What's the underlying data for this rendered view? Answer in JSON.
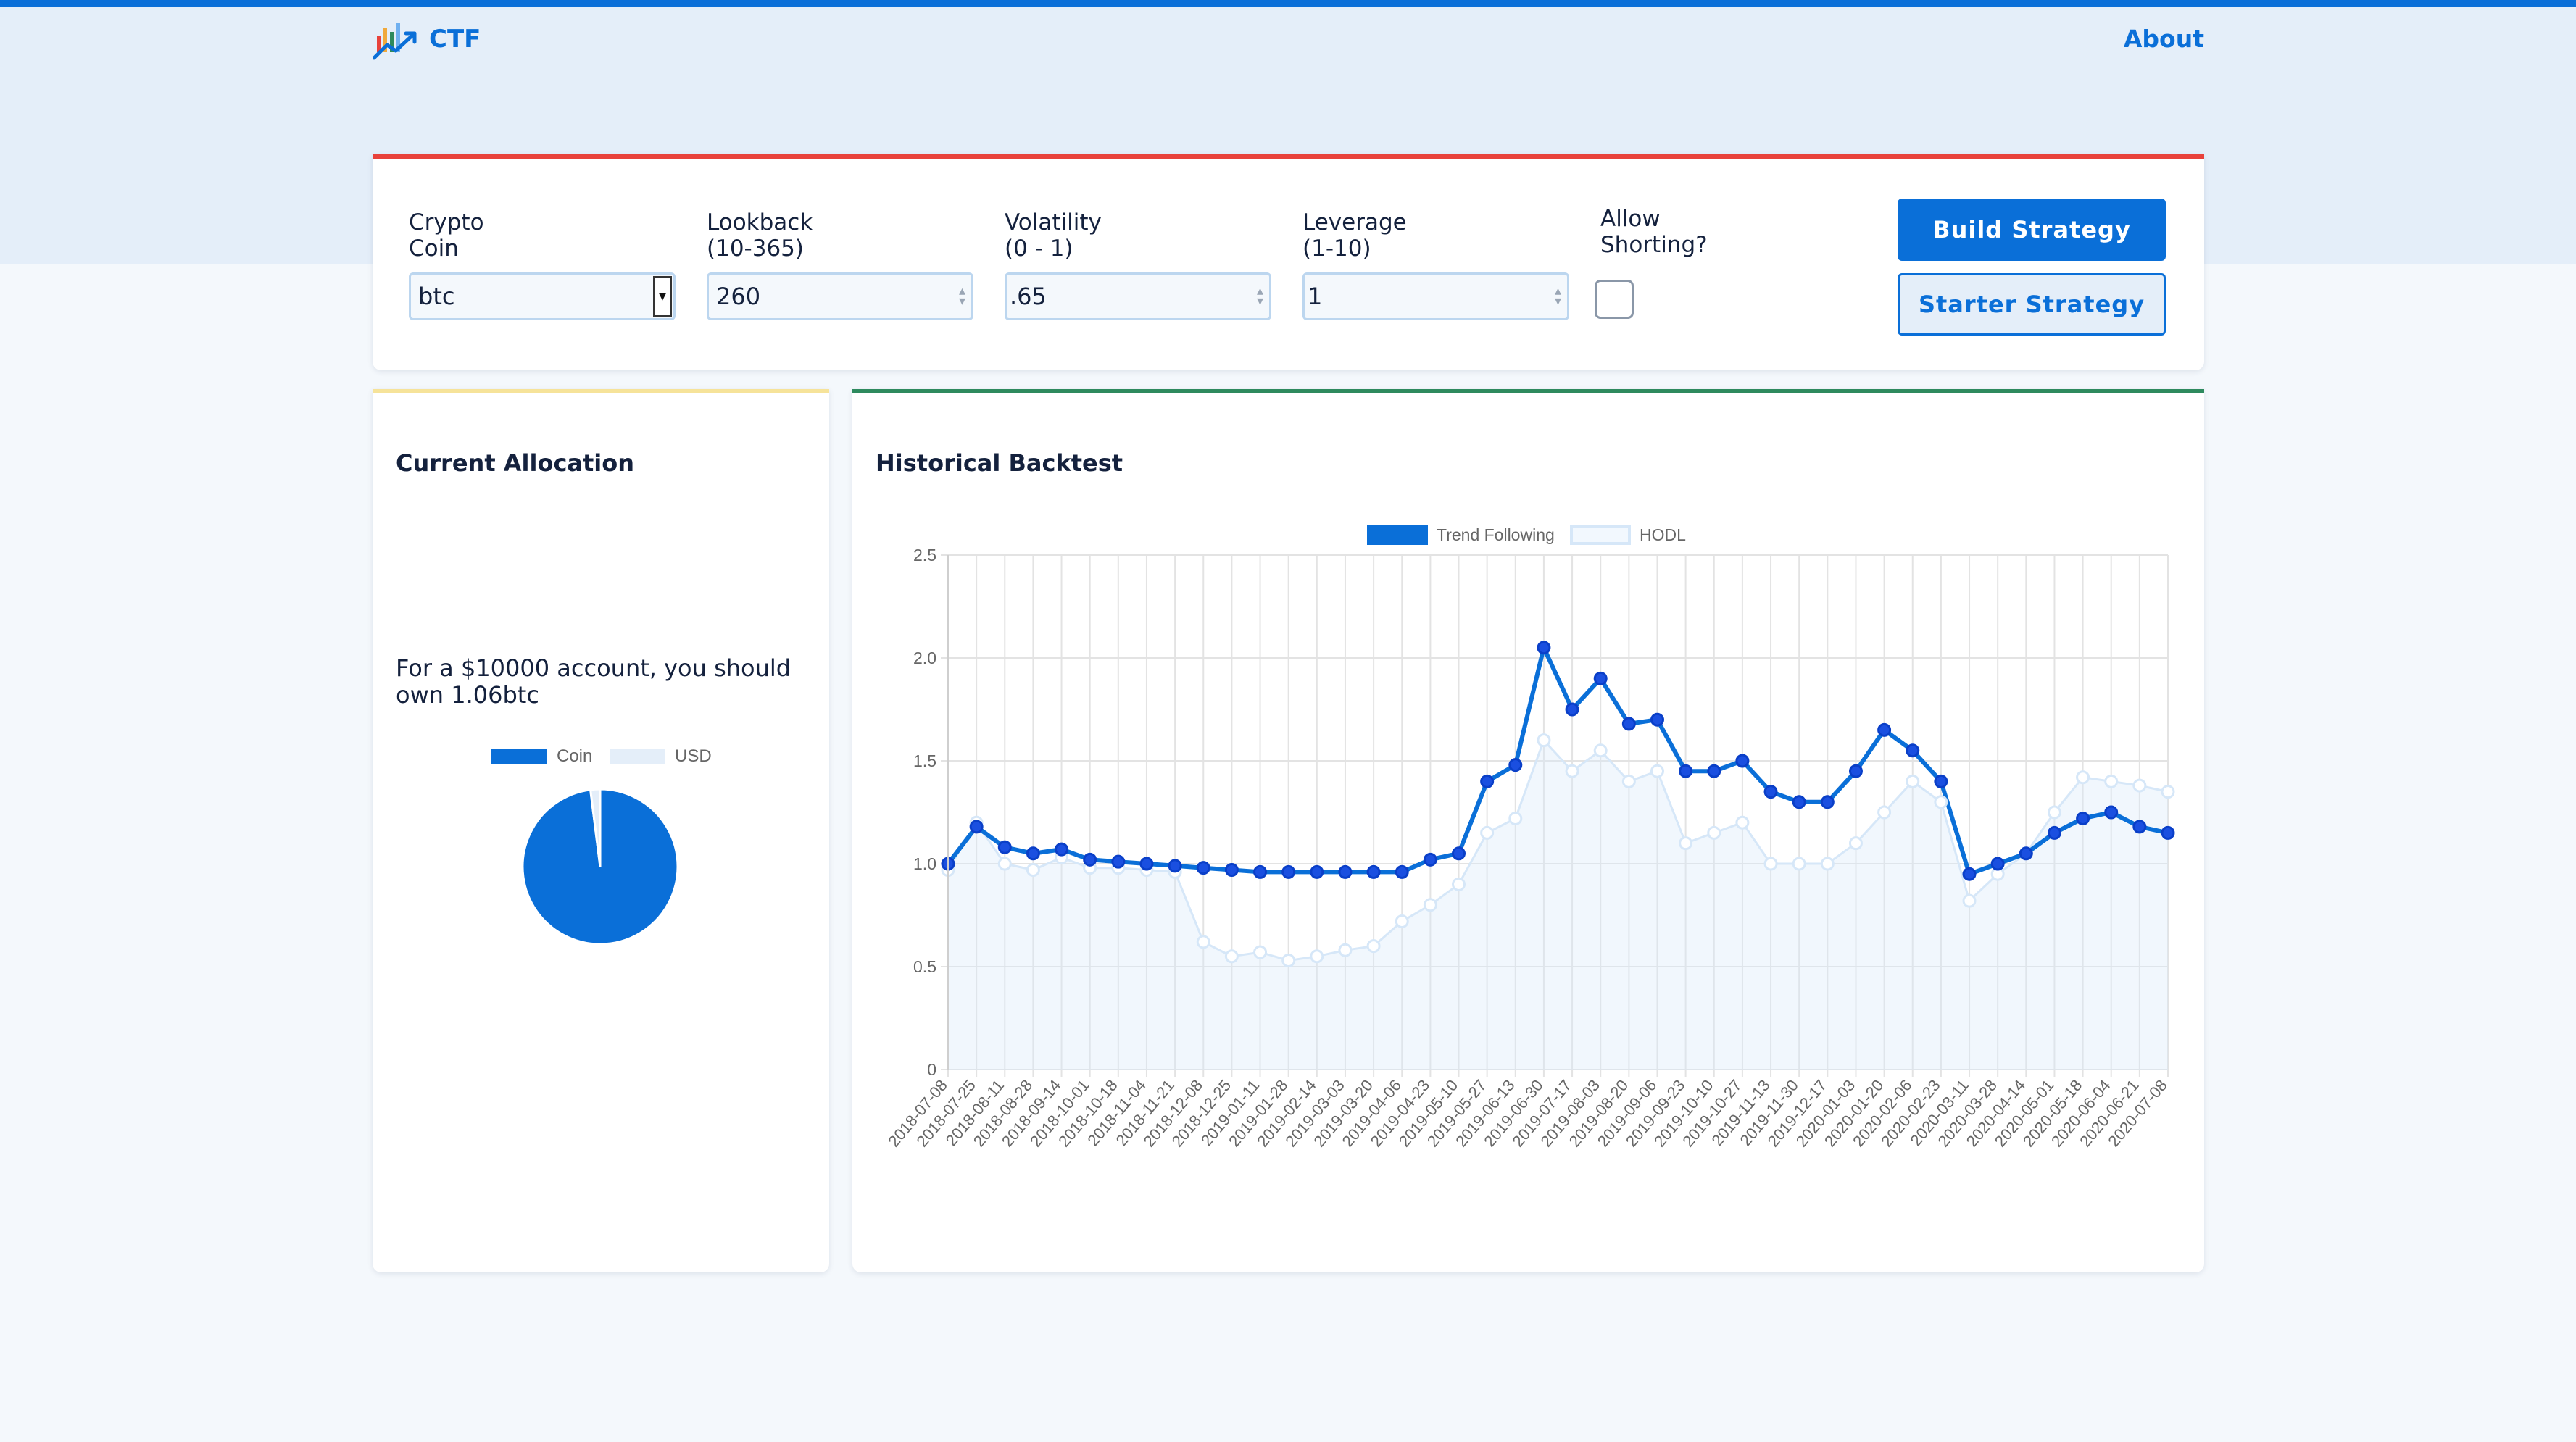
{
  "nav": {
    "brand": "CTF",
    "about": "About"
  },
  "controls": {
    "coin_label": "Crypto\nCoin",
    "coin_value": "btc",
    "lookback_label": "Lookback\n(10-365)",
    "lookback_value": "260",
    "volatility_label": "Volatility\n(0 - 1)",
    "volatility_value": ".65",
    "leverage_label": "Leverage\n(1-10)",
    "leverage_value": "1",
    "shorting_label": "Allow\nShorting?",
    "shorting_checked": false,
    "build_button": "Build Strategy",
    "starter_button": "Starter Strategy"
  },
  "allocation": {
    "title": "Current Allocation",
    "text": "For a $10000 account, you should own 1.06btc",
    "legend_coin": "Coin",
    "legend_usd": "USD",
    "coin_fraction": 0.98,
    "colors": {
      "coin": "#0a6fd8",
      "usd": "#e4eef9"
    }
  },
  "backtest": {
    "title": "Historical Backtest"
  },
  "chart_data": {
    "type": "line",
    "legend": [
      "Trend Following",
      "HODL"
    ],
    "legend_position": "top",
    "ylim": [
      0,
      2.5
    ],
    "yticks": [
      "0",
      "0.5",
      "1.0",
      "1.5",
      "2.0",
      "2.5"
    ],
    "grid": true,
    "x": [
      "2018-07-08",
      "2018-07-25",
      "2018-08-11",
      "2018-08-28",
      "2018-09-14",
      "2018-10-01",
      "2018-10-18",
      "2018-11-04",
      "2018-11-21",
      "2018-12-08",
      "2018-12-25",
      "2019-01-11",
      "2019-01-28",
      "2019-02-14",
      "2019-03-03",
      "2019-03-20",
      "2019-04-06",
      "2019-04-23",
      "2019-05-10",
      "2019-05-27",
      "2019-06-13",
      "2019-06-30",
      "2019-07-17",
      "2019-08-03",
      "2019-08-20",
      "2019-09-06",
      "2019-09-23",
      "2019-10-10",
      "2019-10-27",
      "2019-11-13",
      "2019-11-30",
      "2019-12-17",
      "2020-01-03",
      "2020-01-20",
      "2020-02-06",
      "2020-02-23",
      "2020-03-11",
      "2020-03-28",
      "2020-04-14",
      "2020-05-01",
      "2020-05-18",
      "2020-06-04",
      "2020-06-21",
      "2020-07-08"
    ],
    "series": [
      {
        "name": "Trend Following",
        "color": "#0a6fd8",
        "values": [
          1.0,
          1.18,
          1.08,
          1.05,
          1.07,
          1.02,
          1.01,
          1.0,
          0.99,
          0.98,
          0.97,
          0.96,
          0.96,
          0.96,
          0.96,
          0.96,
          0.96,
          1.02,
          1.05,
          1.4,
          1.48,
          2.05,
          1.75,
          1.9,
          1.68,
          1.7,
          1.45,
          1.45,
          1.5,
          1.35,
          1.3,
          1.3,
          1.45,
          1.65,
          1.55,
          1.4,
          0.95,
          1.0,
          1.05,
          1.15,
          1.22,
          1.25,
          1.18,
          1.15
        ]
      },
      {
        "name": "HODL",
        "color": "#d6e7f8",
        "values": [
          0.97,
          1.2,
          1.0,
          0.97,
          1.03,
          0.98,
          0.98,
          0.97,
          0.96,
          0.62,
          0.55,
          0.57,
          0.53,
          0.55,
          0.58,
          0.6,
          0.72,
          0.8,
          0.9,
          1.15,
          1.22,
          1.6,
          1.45,
          1.55,
          1.4,
          1.45,
          1.1,
          1.15,
          1.2,
          1.0,
          1.0,
          1.0,
          1.1,
          1.25,
          1.4,
          1.3,
          0.82,
          0.95,
          1.05,
          1.25,
          1.42,
          1.4,
          1.38,
          1.35
        ]
      }
    ]
  }
}
